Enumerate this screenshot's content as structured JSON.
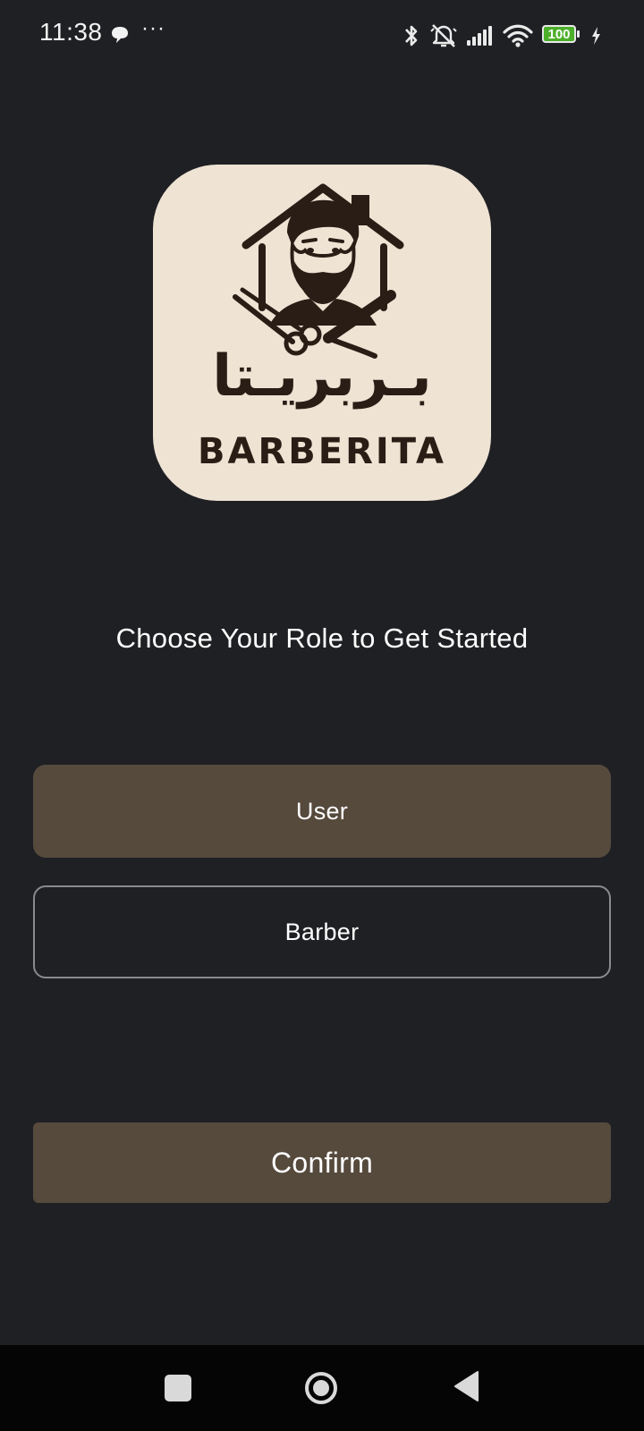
{
  "status_bar": {
    "time": "11:38",
    "more_indicator": "···",
    "battery_level": "100",
    "icons": [
      "message-icon",
      "bluetooth-icon",
      "mute-icon",
      "signal-icon",
      "wifi-icon",
      "battery-icon",
      "charging-icon"
    ]
  },
  "logo": {
    "arabic_name": "بـربريـتا",
    "wordmark": "BARBERITA"
  },
  "page": {
    "title": "Choose Your Role to Get Started"
  },
  "roles": {
    "user_label": "User",
    "barber_label": "Barber",
    "selected": "User"
  },
  "actions": {
    "confirm_label": "Confirm"
  },
  "colors": {
    "background": "#1f2024",
    "accent": "#564a3d",
    "logo_background": "#efe3d4",
    "logo_ink": "#2a1d15"
  },
  "nav_bar": {
    "icons": [
      "recents-icon",
      "home-icon",
      "back-icon"
    ]
  }
}
